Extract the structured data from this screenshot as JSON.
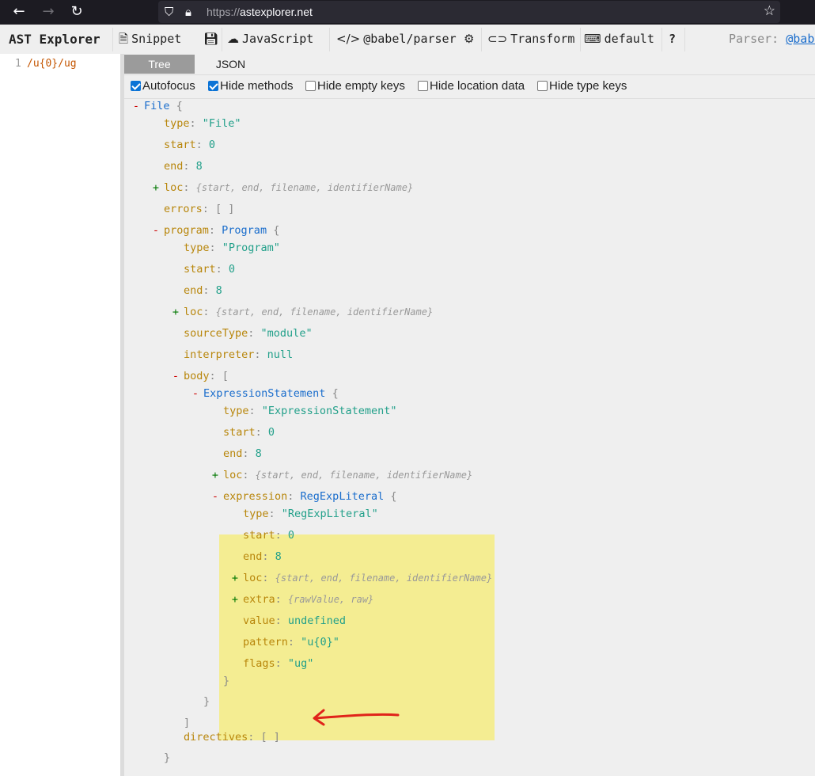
{
  "browser": {
    "url_proto": "https://",
    "url_host": "astexplorer.net",
    "back_icon": "arrow-left",
    "forward_icon": "arrow-right",
    "reload_icon": "reload",
    "shield_icon": "shield",
    "lock_icon": "lock",
    "bookmark_icon": "star"
  },
  "toolbar": {
    "brand": "AST Explorer",
    "snippet": "Snippet",
    "language": "JavaScript",
    "parser": "@babel/parser",
    "transform": "Transform",
    "keymap": "default",
    "help": "?",
    "parser_label": "Parser:",
    "parser_link": "@babel"
  },
  "editor": {
    "line_number": "1",
    "code": "/u{0}/ug"
  },
  "output": {
    "tabs": [
      "Tree",
      "JSON"
    ],
    "active_tab": "Tree",
    "options": [
      {
        "label": "Autofocus",
        "checked": true
      },
      {
        "label": "Hide methods",
        "checked": true
      },
      {
        "label": "Hide empty keys",
        "checked": false
      },
      {
        "label": "Hide location data",
        "checked": false
      },
      {
        "label": "Hide type keys",
        "checked": false
      }
    ]
  },
  "tree": [
    {
      "indent": 0,
      "toggle": "-",
      "key": "",
      "value": "File",
      "vtype": "type",
      "brace": "{"
    },
    {
      "indent": 1,
      "key": "type",
      "value": "\"File\"",
      "vtype": "string"
    },
    {
      "indent": 1,
      "key": "start",
      "value": "0",
      "vtype": "number"
    },
    {
      "indent": 1,
      "key": "end",
      "value": "8",
      "vtype": "number"
    },
    {
      "indent": 1,
      "toggle": "+",
      "key": "loc",
      "value": "{start, end, filename, identifierName}",
      "vtype": "summary"
    },
    {
      "indent": 1,
      "key": "errors",
      "value": "[ ]",
      "vtype": "punct"
    },
    {
      "indent": 1,
      "toggle": "-",
      "key": "program",
      "value": "Program",
      "vtype": "type",
      "brace": "{"
    },
    {
      "indent": 2,
      "key": "type",
      "value": "\"Program\"",
      "vtype": "string"
    },
    {
      "indent": 2,
      "key": "start",
      "value": "0",
      "vtype": "number"
    },
    {
      "indent": 2,
      "key": "end",
      "value": "8",
      "vtype": "number"
    },
    {
      "indent": 2,
      "toggle": "+",
      "key": "loc",
      "value": "{start, end, filename, identifierName}",
      "vtype": "summary"
    },
    {
      "indent": 2,
      "key": "sourceType",
      "value": "\"module\"",
      "vtype": "string"
    },
    {
      "indent": 2,
      "key": "interpreter",
      "value": "null",
      "vtype": "keyword"
    },
    {
      "indent": 2,
      "toggle": "-",
      "key": "body",
      "value": "",
      "vtype": "none",
      "brace": "["
    },
    {
      "indent": 3,
      "toggle": "-",
      "key": "",
      "value": "ExpressionStatement",
      "vtype": "type",
      "brace": "{"
    },
    {
      "indent": 4,
      "key": "type",
      "value": "\"ExpressionStatement\"",
      "vtype": "string"
    },
    {
      "indent": 4,
      "key": "start",
      "value": "0",
      "vtype": "number"
    },
    {
      "indent": 4,
      "key": "end",
      "value": "8",
      "vtype": "number"
    },
    {
      "indent": 4,
      "toggle": "+",
      "key": "loc",
      "value": "{start, end, filename, identifierName}",
      "vtype": "summary"
    },
    {
      "indent": 4,
      "toggle": "-",
      "key": "expression",
      "value": "RegExpLiteral",
      "vtype": "type",
      "brace": "{"
    },
    {
      "indent": 5,
      "key": "type",
      "value": "\"RegExpLiteral\"",
      "vtype": "string"
    },
    {
      "indent": 5,
      "key": "start",
      "value": "0",
      "vtype": "number"
    },
    {
      "indent": 5,
      "key": "end",
      "value": "8",
      "vtype": "number"
    },
    {
      "indent": 5,
      "toggle": "+",
      "key": "loc",
      "value": "{start, end, filename, identifierName}",
      "vtype": "summary"
    },
    {
      "indent": 5,
      "toggle": "+",
      "key": "extra",
      "value": "{rawValue, raw}",
      "vtype": "summary"
    },
    {
      "indent": 5,
      "key": "value",
      "value": "undefined",
      "vtype": "keyword"
    },
    {
      "indent": 5,
      "key": "pattern",
      "value": "\"u{0}\"",
      "vtype": "string"
    },
    {
      "indent": 5,
      "key": "flags",
      "value": "\"ug\"",
      "vtype": "string"
    },
    {
      "indent": 4,
      "key": "",
      "value": "}",
      "vtype": "punct"
    },
    {
      "indent": 3,
      "key": "",
      "value": "}",
      "vtype": "punct"
    },
    {
      "indent": 2,
      "key": "",
      "value": "]",
      "vtype": "punct"
    },
    {
      "indent": 2,
      "key": "directives",
      "value": "[ ]",
      "vtype": "punct"
    },
    {
      "indent": 1,
      "key": "",
      "value": "}",
      "vtype": "punct"
    }
  ],
  "annotation": {
    "arrow_color": "#e0231a"
  }
}
